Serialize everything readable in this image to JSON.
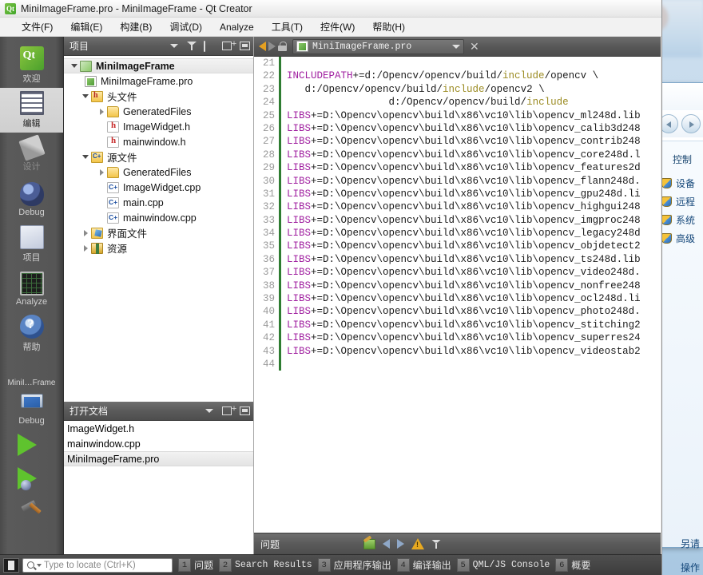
{
  "window": {
    "title": "MiniImageFrame.pro - MiniImageFrame - Qt Creator",
    "logo_text": "Qt"
  },
  "menubar": {
    "items": [
      {
        "label": "文件(F)",
        "name": "menu-file"
      },
      {
        "label": "编辑(E)",
        "name": "menu-edit"
      },
      {
        "label": "构建(B)",
        "name": "menu-build"
      },
      {
        "label": "调试(D)",
        "name": "menu-debug"
      },
      {
        "label": "Analyze",
        "name": "menu-analyze"
      },
      {
        "label": "工具(T)",
        "name": "menu-tools"
      },
      {
        "label": "控件(W)",
        "name": "menu-window"
      },
      {
        "label": "帮助(H)",
        "name": "menu-help"
      }
    ]
  },
  "modebar": {
    "items": [
      {
        "label": "欢迎",
        "icon": "qt-welcome-icon",
        "state": "normal"
      },
      {
        "label": "编辑",
        "icon": "edit-document-icon",
        "state": "active"
      },
      {
        "label": "设计",
        "icon": "design-brush-icon",
        "state": "disabled"
      },
      {
        "label": "Debug",
        "icon": "debug-bug-icon",
        "state": "normal"
      },
      {
        "label": "项目",
        "icon": "projects-book-icon",
        "state": "normal"
      },
      {
        "label": "Analyze",
        "icon": "analyze-grid-icon",
        "state": "normal"
      },
      {
        "label": "帮助",
        "icon": "help-question-icon",
        "state": "normal"
      }
    ],
    "kit_label": "MiniI…Frame",
    "target_label": "Debug",
    "run_icon": "run-play-icon",
    "debug_icon": "run-debug-icon",
    "build_icon": "build-hammer-icon"
  },
  "project_dock": {
    "title": "项目",
    "buttons": [
      "filter-icon",
      "link-icon",
      "split-icon",
      "popout-icon"
    ],
    "tree": [
      {
        "label": "MiniImageFrame",
        "indent": 0,
        "twisty": "open",
        "icon": "qt-project-icon",
        "bold": true,
        "selected": true
      },
      {
        "label": "MiniImageFrame.pro",
        "indent": 1,
        "twisty": "none",
        "icon": "pro-file-icon",
        "bold": false,
        "selected": false
      },
      {
        "label": "头文件",
        "indent": 1,
        "twisty": "open",
        "icon": "headers-folder-icon",
        "bold": false,
        "selected": false
      },
      {
        "label": "GeneratedFiles",
        "indent": 2,
        "twisty": "closed",
        "icon": "folder-icon",
        "bold": false,
        "selected": false
      },
      {
        "label": "ImageWidget.h",
        "indent": 2,
        "twisty": "none",
        "icon": "header-file-icon",
        "bold": false,
        "selected": false
      },
      {
        "label": "mainwindow.h",
        "indent": 2,
        "twisty": "none",
        "icon": "header-file-icon",
        "bold": false,
        "selected": false
      },
      {
        "label": "源文件",
        "indent": 1,
        "twisty": "open",
        "icon": "sources-folder-icon",
        "bold": false,
        "selected": false
      },
      {
        "label": "GeneratedFiles",
        "indent": 2,
        "twisty": "closed",
        "icon": "folder-icon",
        "bold": false,
        "selected": false
      },
      {
        "label": "ImageWidget.cpp",
        "indent": 2,
        "twisty": "none",
        "icon": "cpp-file-icon",
        "bold": false,
        "selected": false
      },
      {
        "label": "main.cpp",
        "indent": 2,
        "twisty": "none",
        "icon": "cpp-file-icon",
        "bold": false,
        "selected": false
      },
      {
        "label": "mainwindow.cpp",
        "indent": 2,
        "twisty": "none",
        "icon": "cpp-file-icon",
        "bold": false,
        "selected": false
      },
      {
        "label": "界面文件",
        "indent": 1,
        "twisty": "closed",
        "icon": "ui-folder-icon",
        "bold": false,
        "selected": false
      },
      {
        "label": "资源",
        "indent": 1,
        "twisty": "closed",
        "icon": "resource-folder-icon",
        "bold": false,
        "selected": false
      }
    ]
  },
  "opendocs_dock": {
    "title": "打开文档",
    "items": [
      {
        "label": "ImageWidget.h",
        "selected": false
      },
      {
        "label": "mainwindow.cpp",
        "selected": false
      },
      {
        "label": "MiniImageFrame.pro",
        "selected": true
      }
    ]
  },
  "editor_toolbar": {
    "back_icon": "nav-back-icon",
    "forward_icon": "nav-forward-icon",
    "lock_icon": "unlocked-icon",
    "file_icon": "pro-file-icon",
    "filename": "MiniImageFrame.pro",
    "close_label": "✕"
  },
  "editor": {
    "first_line": 21,
    "lines": [
      {
        "n": 21,
        "segments": [
          {
            "t": "",
            "c": "plain"
          }
        ]
      },
      {
        "n": 22,
        "segments": [
          {
            "t": "INCLUDEPATH",
            "c": "kw"
          },
          {
            "t": "+=d:/Opencv/opencv/build/",
            "c": "plain"
          },
          {
            "t": "include",
            "c": "inc"
          },
          {
            "t": "/opencv \\",
            "c": "plain"
          }
        ]
      },
      {
        "n": 23,
        "segments": [
          {
            "t": "   d:/Opencv/opencv/build/",
            "c": "plain"
          },
          {
            "t": "include",
            "c": "inc"
          },
          {
            "t": "/opencv2 \\",
            "c": "plain"
          }
        ]
      },
      {
        "n": 24,
        "segments": [
          {
            "t": "                 d:/Opencv/opencv/build/",
            "c": "plain"
          },
          {
            "t": "include",
            "c": "inc"
          }
        ]
      },
      {
        "n": 25,
        "segments": [
          {
            "t": "LIBS",
            "c": "kw"
          },
          {
            "t": "+=D:\\Opencv\\opencv\\build\\x86\\vc10\\lib\\opencv_ml248d.lib",
            "c": "plain"
          }
        ]
      },
      {
        "n": 26,
        "segments": [
          {
            "t": "LIBS",
            "c": "kw"
          },
          {
            "t": "+=D:\\Opencv\\opencv\\build\\x86\\vc10\\lib\\opencv_calib3d248",
            "c": "plain"
          }
        ]
      },
      {
        "n": 27,
        "segments": [
          {
            "t": "LIBS",
            "c": "kw"
          },
          {
            "t": "+=D:\\Opencv\\opencv\\build\\x86\\vc10\\lib\\opencv_contrib248",
            "c": "plain"
          }
        ]
      },
      {
        "n": 28,
        "segments": [
          {
            "t": "LIBS",
            "c": "kw"
          },
          {
            "t": "+=D:\\Opencv\\opencv\\build\\x86\\vc10\\lib\\opencv_core248d.l",
            "c": "plain"
          }
        ]
      },
      {
        "n": 29,
        "segments": [
          {
            "t": "LIBS",
            "c": "kw"
          },
          {
            "t": "+=D:\\Opencv\\opencv\\build\\x86\\vc10\\lib\\opencv_features2d",
            "c": "plain"
          }
        ]
      },
      {
        "n": 30,
        "segments": [
          {
            "t": "LIBS",
            "c": "kw"
          },
          {
            "t": "+=D:\\Opencv\\opencv\\build\\x86\\vc10\\lib\\opencv_flann248d.",
            "c": "plain"
          }
        ]
      },
      {
        "n": 31,
        "segments": [
          {
            "t": "LIBS",
            "c": "kw"
          },
          {
            "t": "+=D:\\Opencv\\opencv\\build\\x86\\vc10\\lib\\opencv_gpu248d.li",
            "c": "plain"
          }
        ]
      },
      {
        "n": 32,
        "segments": [
          {
            "t": "LIBS",
            "c": "kw"
          },
          {
            "t": "+=D:\\Opencv\\opencv\\build\\x86\\vc10\\lib\\opencv_highgui248",
            "c": "plain"
          }
        ]
      },
      {
        "n": 33,
        "segments": [
          {
            "t": "LIBS",
            "c": "kw"
          },
          {
            "t": "+=D:\\Opencv\\opencv\\build\\x86\\vc10\\lib\\opencv_imgproc248",
            "c": "plain"
          }
        ]
      },
      {
        "n": 34,
        "segments": [
          {
            "t": "LIBS",
            "c": "kw"
          },
          {
            "t": "+=D:\\Opencv\\opencv\\build\\x86\\vc10\\lib\\opencv_legacy248d",
            "c": "plain"
          }
        ]
      },
      {
        "n": 35,
        "segments": [
          {
            "t": "LIBS",
            "c": "kw"
          },
          {
            "t": "+=D:\\Opencv\\opencv\\build\\x86\\vc10\\lib\\opencv_objdetect2",
            "c": "plain"
          }
        ]
      },
      {
        "n": 36,
        "segments": [
          {
            "t": "LIBS",
            "c": "kw"
          },
          {
            "t": "+=D:\\Opencv\\opencv\\build\\x86\\vc10\\lib\\opencv_ts248d.lib",
            "c": "plain"
          }
        ]
      },
      {
        "n": 37,
        "segments": [
          {
            "t": "LIBS",
            "c": "kw"
          },
          {
            "t": "+=D:\\Opencv\\opencv\\build\\x86\\vc10\\lib\\opencv_video248d.",
            "c": "plain"
          }
        ]
      },
      {
        "n": 38,
        "segments": [
          {
            "t": "LIBS",
            "c": "kw"
          },
          {
            "t": "+=D:\\Opencv\\opencv\\build\\x86\\vc10\\lib\\opencv_nonfree248",
            "c": "plain"
          }
        ]
      },
      {
        "n": 39,
        "segments": [
          {
            "t": "LIBS",
            "c": "kw"
          },
          {
            "t": "+=D:\\Opencv\\opencv\\build\\x86\\vc10\\lib\\opencv_ocl248d.li",
            "c": "plain"
          }
        ]
      },
      {
        "n": 40,
        "segments": [
          {
            "t": "LIBS",
            "c": "kw"
          },
          {
            "t": "+=D:\\Opencv\\opencv\\build\\x86\\vc10\\lib\\opencv_photo248d.",
            "c": "plain"
          }
        ]
      },
      {
        "n": 41,
        "segments": [
          {
            "t": "LIBS",
            "c": "kw"
          },
          {
            "t": "+=D:\\Opencv\\opencv\\build\\x86\\vc10\\lib\\opencv_stitching2",
            "c": "plain"
          }
        ]
      },
      {
        "n": 42,
        "segments": [
          {
            "t": "LIBS",
            "c": "kw"
          },
          {
            "t": "+=D:\\Opencv\\opencv\\build\\x86\\vc10\\lib\\opencv_superres24",
            "c": "plain"
          }
        ]
      },
      {
        "n": 43,
        "segments": [
          {
            "t": "LIBS",
            "c": "kw"
          },
          {
            "t": "+=D:\\Opencv\\opencv\\build\\x86\\vc10\\lib\\opencv_videostab2",
            "c": "plain"
          }
        ]
      },
      {
        "n": 44,
        "segments": [
          {
            "t": "",
            "c": "plain"
          }
        ]
      }
    ]
  },
  "issues_dock": {
    "title": "问题",
    "buttons": [
      "clear-icon",
      "prev-issue-icon",
      "next-issue-icon",
      "warning-filter-icon",
      "filter-icon"
    ]
  },
  "statusbar": {
    "toggle_sidebar_icon": "toggle-sidebar-icon",
    "locator_placeholder": "Type to locate (Ctrl+K)",
    "search_icon": "search-icon",
    "output_tabs": [
      {
        "num": "1",
        "label": "问题",
        "cjk": true
      },
      {
        "num": "2",
        "label": "Search Results",
        "cjk": false
      },
      {
        "num": "3",
        "label": "应用程序输出",
        "cjk": true
      },
      {
        "num": "4",
        "label": "编译输出",
        "cjk": true
      },
      {
        "num": "5",
        "label": "QML/JS Console",
        "cjk": false
      },
      {
        "num": "6",
        "label": "概要",
        "cjk": true
      }
    ]
  },
  "control_panel": {
    "heading": "控制",
    "links": [
      {
        "label": "设备"
      },
      {
        "label": "远程"
      },
      {
        "label": "系统"
      },
      {
        "label": "高级"
      }
    ],
    "footer_a": "另请",
    "footer_b": "操作"
  }
}
